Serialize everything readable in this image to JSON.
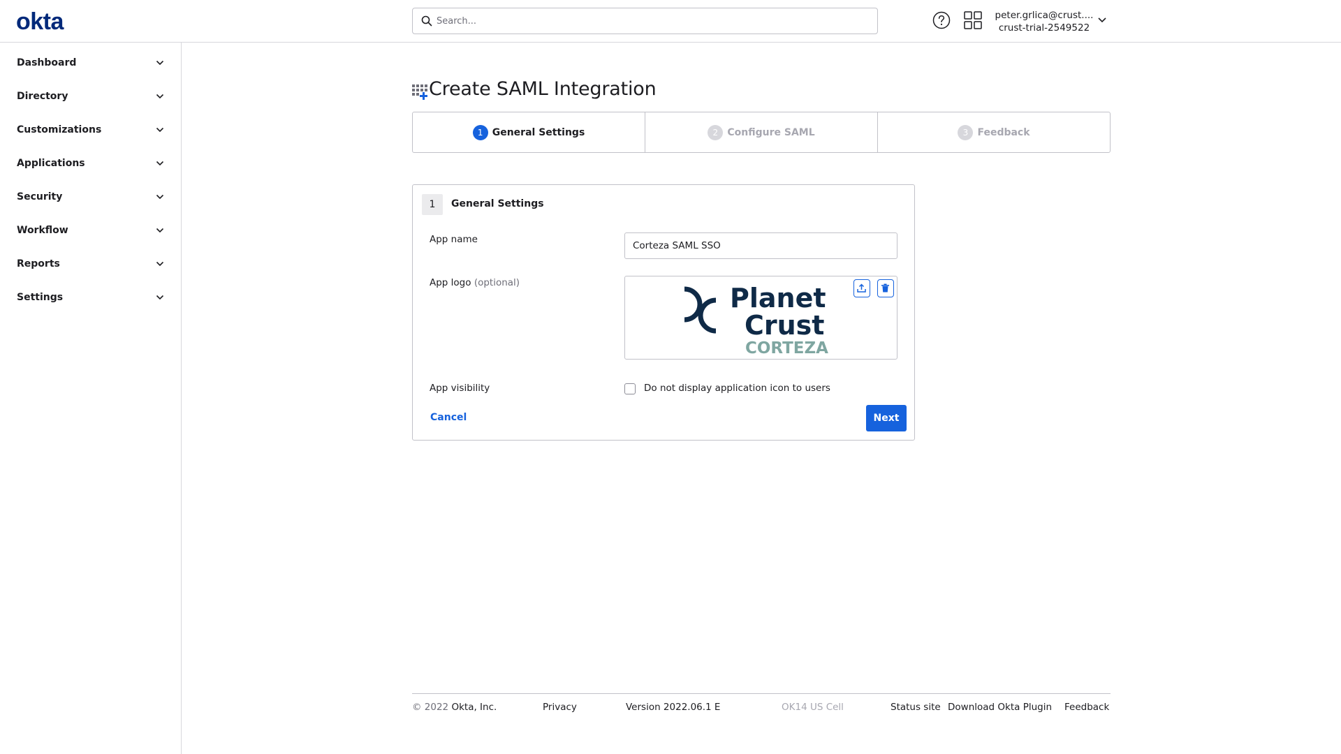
{
  "header": {
    "logo_text": "okta",
    "search_placeholder": "Search...",
    "user_email": "peter.grlica@crust....",
    "user_org": "crust-trial-2549522"
  },
  "sidebar": {
    "items": [
      {
        "label": "Dashboard"
      },
      {
        "label": "Directory"
      },
      {
        "label": "Customizations"
      },
      {
        "label": "Applications"
      },
      {
        "label": "Security"
      },
      {
        "label": "Workflow"
      },
      {
        "label": "Reports"
      },
      {
        "label": "Settings"
      }
    ]
  },
  "main": {
    "title": "Create SAML Integration",
    "steps": [
      {
        "num": "1",
        "label": "General Settings",
        "state": "active"
      },
      {
        "num": "2",
        "label": "Configure SAML",
        "state": "inactive"
      },
      {
        "num": "3",
        "label": "Feedback",
        "state": "inactive"
      }
    ],
    "card": {
      "num": "1",
      "title": "General Settings",
      "app_name_label": "App name",
      "app_name_value": "Corteza SAML SSO",
      "app_logo_label": "App logo",
      "app_logo_optional": "(optional)",
      "logo_text_line1": "Planet",
      "logo_text_line2": "Crust",
      "logo_text_line3": "CORTEZA",
      "app_visibility_label": "App visibility",
      "visibility_checkbox_label": "Do not display application icon to users",
      "visibility_checked": false,
      "cancel_label": "Cancel",
      "next_label": "Next"
    }
  },
  "footer": {
    "copyright_symbol_year": "© 2022",
    "company": "Okta, Inc.",
    "privacy": "Privacy",
    "version": "Version 2022.06.1 E",
    "cell": "OK14 US Cell",
    "status_site": "Status site",
    "download_plugin": "Download Okta Plugin",
    "feedback": "Feedback"
  },
  "colors": {
    "brand": "#00297a",
    "accent": "#1662dd",
    "logo_dark": "#0f2a47",
    "logo_teal": "#7fa6a1"
  }
}
